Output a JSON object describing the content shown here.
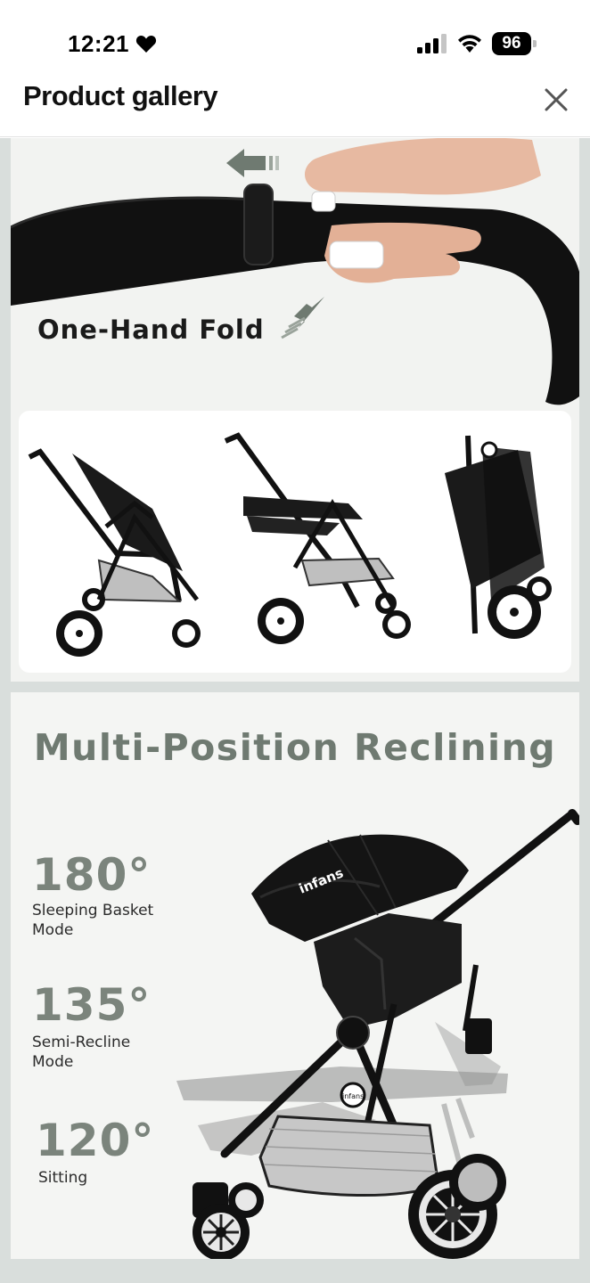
{
  "status_bar": {
    "time": "12:21",
    "battery": "96",
    "icons": [
      "heart-icon",
      "signal-icon",
      "wifi-icon",
      "battery-icon"
    ]
  },
  "header": {
    "title": "Product gallery",
    "close_icon": "close-icon"
  },
  "gallery": {
    "slide_1": {
      "caption": "One-Hand Fold"
    },
    "slide_2": {
      "title": "Multi-Position Reclining",
      "brand": "infans",
      "positions": [
        {
          "angle": "180°",
          "label": "Sleeping Basket Mode"
        },
        {
          "angle": "135°",
          "label": "Semi-Recline Mode"
        },
        {
          "angle": "120°",
          "label": "Sitting"
        }
      ]
    }
  },
  "colors": {
    "title_green": "#6f7a71",
    "angle_green": "#7b847c",
    "gallery_bg": "#d9dedc"
  }
}
